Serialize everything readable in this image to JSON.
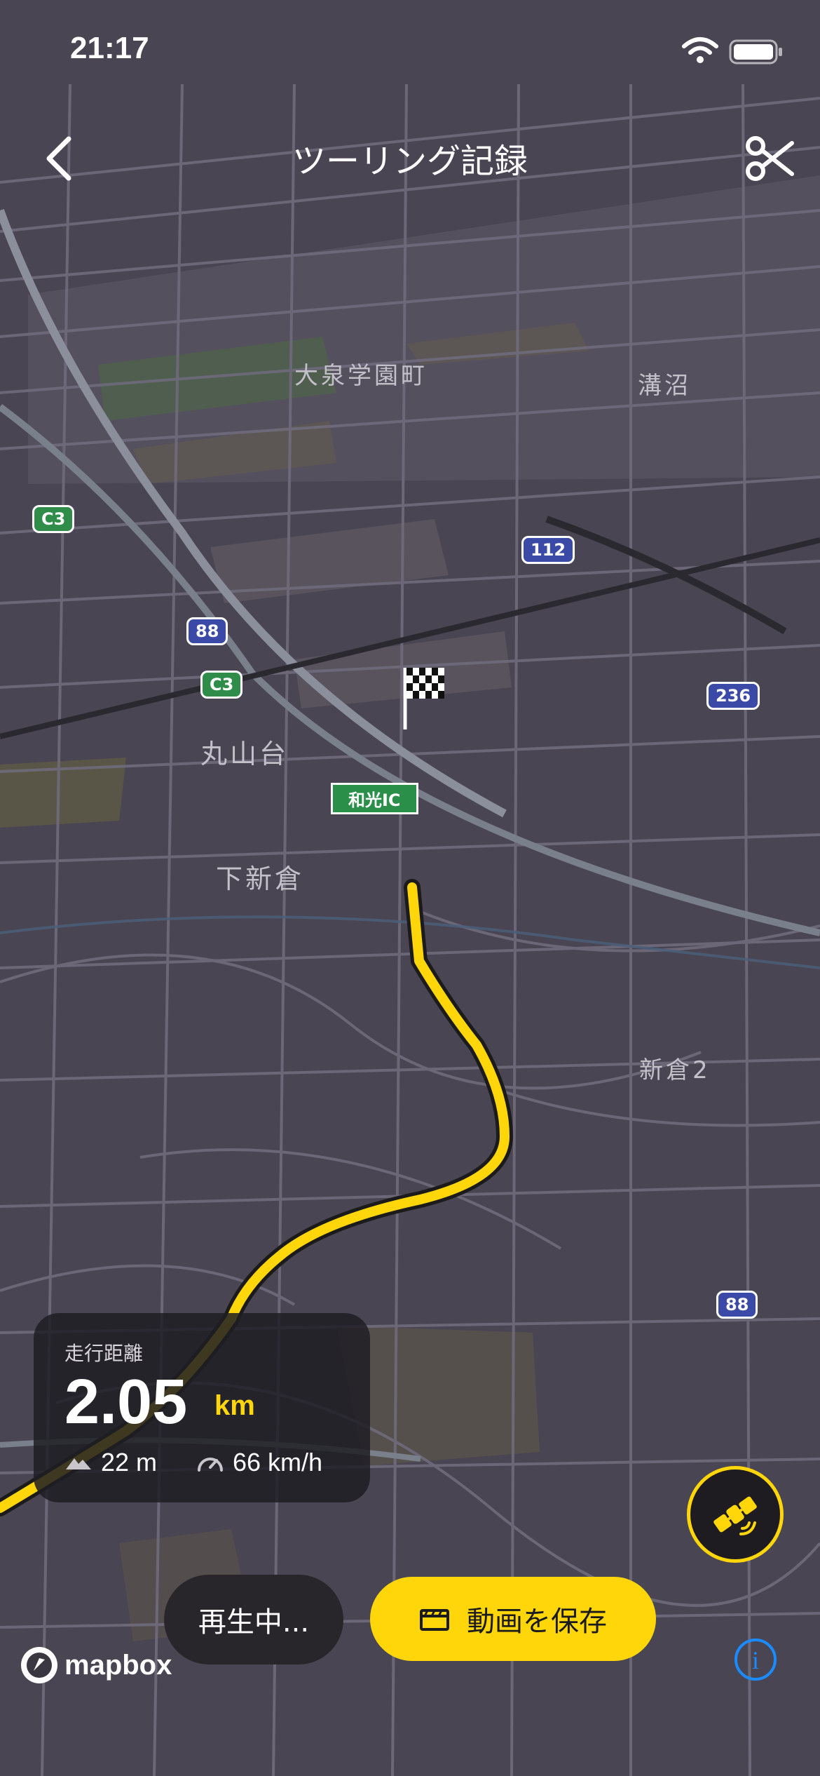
{
  "status_bar": {
    "time": "21:17"
  },
  "nav": {
    "title": "ツーリング記録",
    "back_icon": "chevron-left-icon",
    "trim_icon": "scissors-icon"
  },
  "map": {
    "places": [
      "大泉学園町",
      "溝沼",
      "丸山台",
      "下新倉",
      "新倉2"
    ],
    "route_shields": [
      "C3",
      "112",
      "88",
      "C3",
      "236",
      "88"
    ],
    "interchange_label": "和光IC",
    "route_color": "#ffd60a"
  },
  "stats": {
    "distance_label": "走行距離",
    "distance_value": "2.05",
    "distance_unit": "km",
    "elevation": "22 m",
    "speed": "66 km/h"
  },
  "controls": {
    "satellite_icon": "satellite-icon",
    "playing_label": "再生中...",
    "save_label": "動画を保存",
    "save_icon": "clapperboard-icon"
  },
  "attribution": {
    "logo_text": "mapbox",
    "info_symbol": "i"
  },
  "colors": {
    "accent": "#ffd60a",
    "info": "#1a8cff",
    "map_bg": "#4a4553"
  }
}
